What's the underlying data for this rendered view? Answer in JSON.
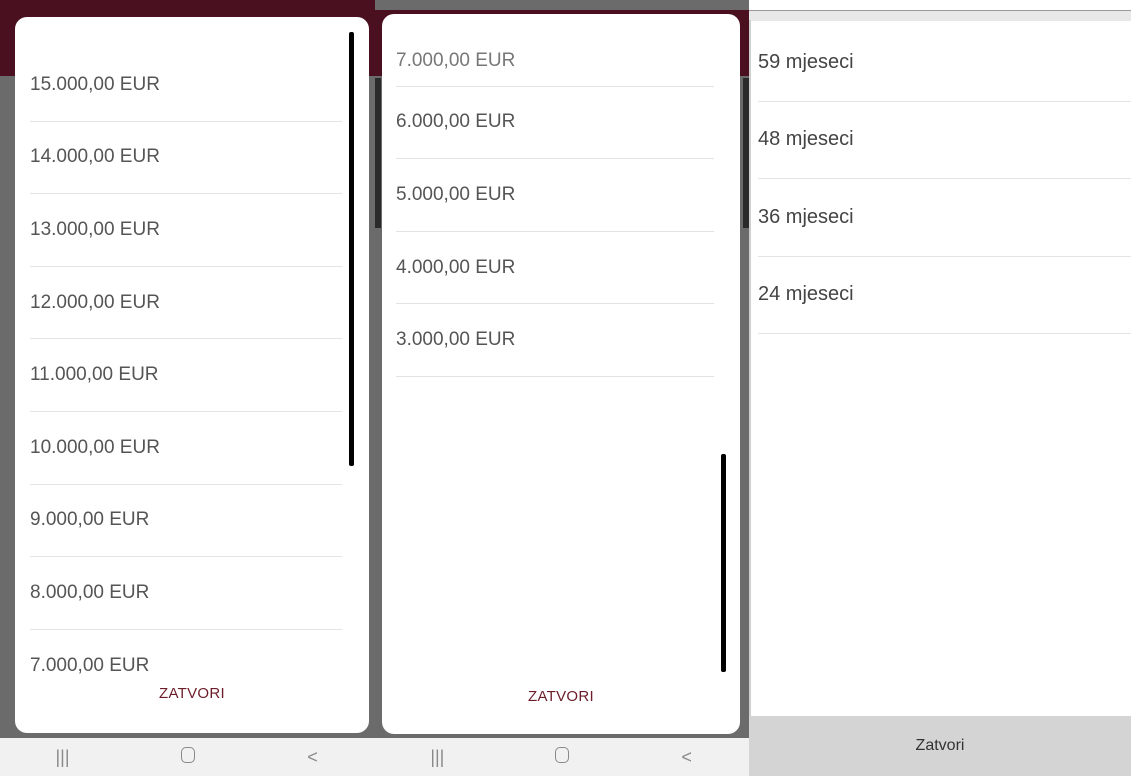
{
  "panel_amounts_a": {
    "items": [
      "15.000,00 EUR",
      "14.000,00 EUR",
      "13.000,00 EUR",
      "12.000,00 EUR",
      "11.000,00 EUR",
      "10.000,00 EUR",
      "9.000,00 EUR",
      "8.000,00 EUR",
      "7.000,00 EUR"
    ],
    "close_label": "ZATVORI"
  },
  "panel_amounts_b": {
    "partial_item": "7.000,00 EUR",
    "items": [
      "6.000,00 EUR",
      "5.000,00 EUR",
      "4.000,00 EUR",
      "3.000,00 EUR"
    ],
    "close_label": "ZATVORI"
  },
  "panel_months": {
    "items": [
      "59 mjeseci",
      "48 mjeseci",
      "36 mjeseci",
      "24 mjeseci"
    ],
    "close_label": "Zatvori"
  },
  "navbar": {
    "recents_glyph": "|||",
    "back_glyph": "<"
  },
  "colors": {
    "accent": "#6b1d2a",
    "scrim": "#6b6b6b",
    "header_maroon": "#4a1020"
  }
}
